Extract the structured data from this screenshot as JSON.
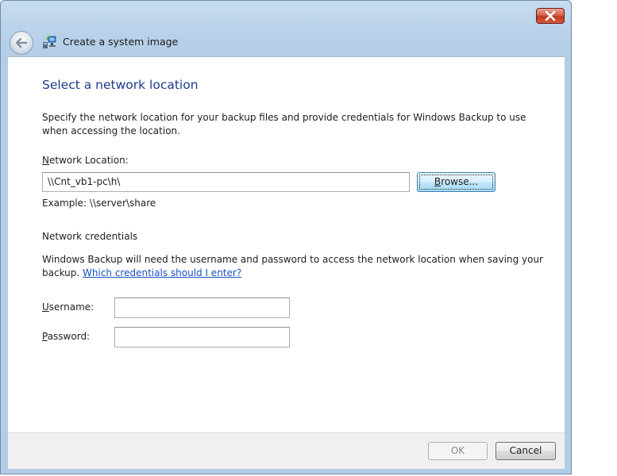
{
  "window": {
    "title": "Create a system image",
    "icons": {
      "back": "back-arrow-icon",
      "app": "system-image-icon",
      "close": "close-icon"
    },
    "colors": {
      "close_button": "#c23a1f",
      "heading": "#1e3b8c",
      "link": "#1a4fc4"
    }
  },
  "page": {
    "heading": "Select a network location",
    "description": "Specify the network location for your backup files and provide credentials for Windows Backup to use when accessing the location.",
    "network_location": {
      "label_accel": "N",
      "label_rest": "etwork Location:",
      "value": "\\\\Cnt_vb1-pc\\h\\",
      "browse_accel": "B",
      "browse_rest": "rowse...",
      "example": "Example: \\\\server\\share"
    },
    "credentials": {
      "heading": "Network credentials",
      "description": "Windows Backup will need the username and password to access the network location when saving your backup.",
      "help_link": "Which credentials should I enter?",
      "username_accel": "U",
      "username_rest": "sername:",
      "username_value": "",
      "password_accel": "P",
      "password_rest": "assword:",
      "password_value": ""
    }
  },
  "footer": {
    "ok_label": "OK",
    "cancel_label": "Cancel"
  }
}
